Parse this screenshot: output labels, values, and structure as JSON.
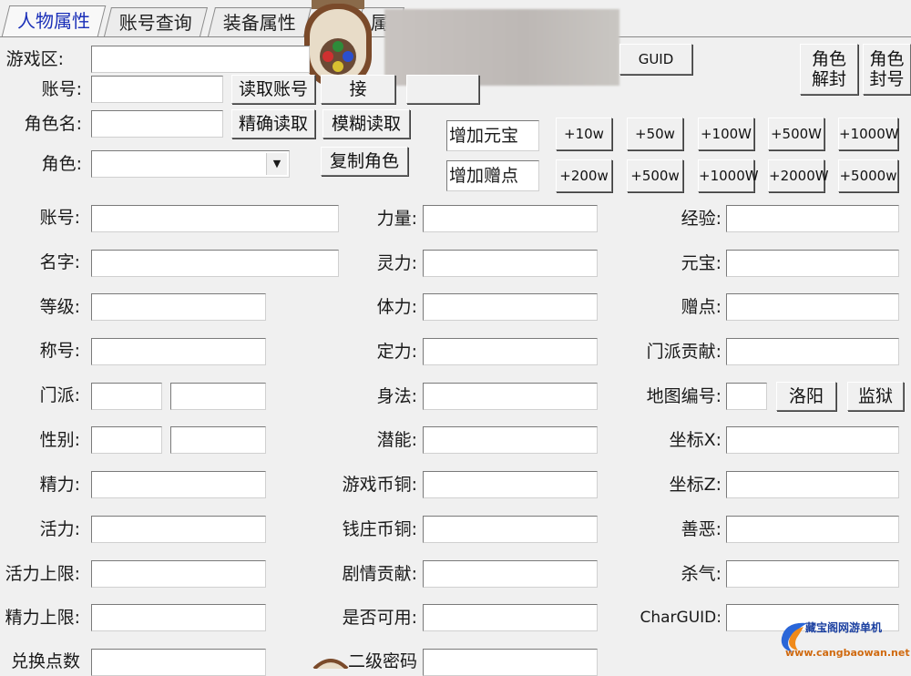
{
  "tabs": [
    "人物属性",
    "账号查询",
    "装备属性",
    "属"
  ],
  "top": {
    "zone_label": "游戏区:",
    "account_label": "账号:",
    "read_account_btn": "读取账号",
    "char_name_label": "角色名:",
    "exact_read_btn": "精确读取",
    "fuzzy_read_btn": "模糊读取",
    "role_label": "角色:",
    "copy_role_btn": "复制角色",
    "hidden_btn": "接",
    "guid_btn": "GUID",
    "unlock_btn": "角色\n解封",
    "ban_btn": "角色\n封号"
  },
  "currency": {
    "add_yuanbao_label": "增加元宝",
    "add_zengdian_label": "增加赠点",
    "yuanbao_buttons": [
      "+10w",
      "+50w",
      "+100W",
      "+500W",
      "+1000W"
    ],
    "zengdian_buttons": [
      "+200w",
      "+500w",
      "+1000W",
      "+2000W",
      "+5000w"
    ]
  },
  "left_fields": [
    "账号:",
    "名字:",
    "等级:",
    "称号:",
    "门派:",
    "性别:",
    "精力:",
    "活力:",
    "活力上限:",
    "精力上限:",
    "兑换点数"
  ],
  "mid_fields": [
    "力量:",
    "灵力:",
    "体力:",
    "定力:",
    "身法:",
    "潜能:",
    "游戏币铜:",
    "钱庄币铜:",
    "剧情贡献:",
    "是否可用:",
    "二级密码"
  ],
  "right_fields": [
    "经验:",
    "元宝:",
    "赠点:",
    "门派贡献:",
    "地图编号:",
    "坐标X:",
    "坐标Z:",
    "善恶:",
    "杀气:",
    "CharGUID:"
  ],
  "map_buttons": [
    "洛阳",
    "监狱"
  ],
  "watermark": {
    "title": "藏宝阁网游单机",
    "url": "www.cangbaowan.net"
  },
  "colors": {
    "active_tab": "#1a2fb8",
    "background": "#f0f0f0"
  }
}
